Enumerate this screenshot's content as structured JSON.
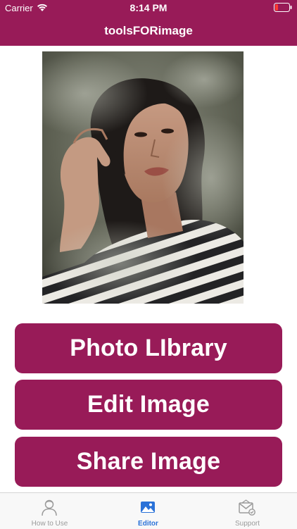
{
  "status_bar": {
    "carrier": "Carrier",
    "time": "8:14 PM"
  },
  "nav": {
    "title": "toolsFORimage"
  },
  "actions": {
    "photo_library": "Photo LIbrary",
    "edit_image": "Edit Image",
    "share_image": "Share Image"
  },
  "tabs": [
    {
      "label": "How to Use",
      "icon": "person-icon"
    },
    {
      "label": "Editor",
      "icon": "image-icon"
    },
    {
      "label": "Support",
      "icon": "mail-icon"
    }
  ],
  "colors": {
    "brand": "#981b58",
    "tab_active": "#2a72d8",
    "tab_inactive": "#9a9a9a"
  }
}
